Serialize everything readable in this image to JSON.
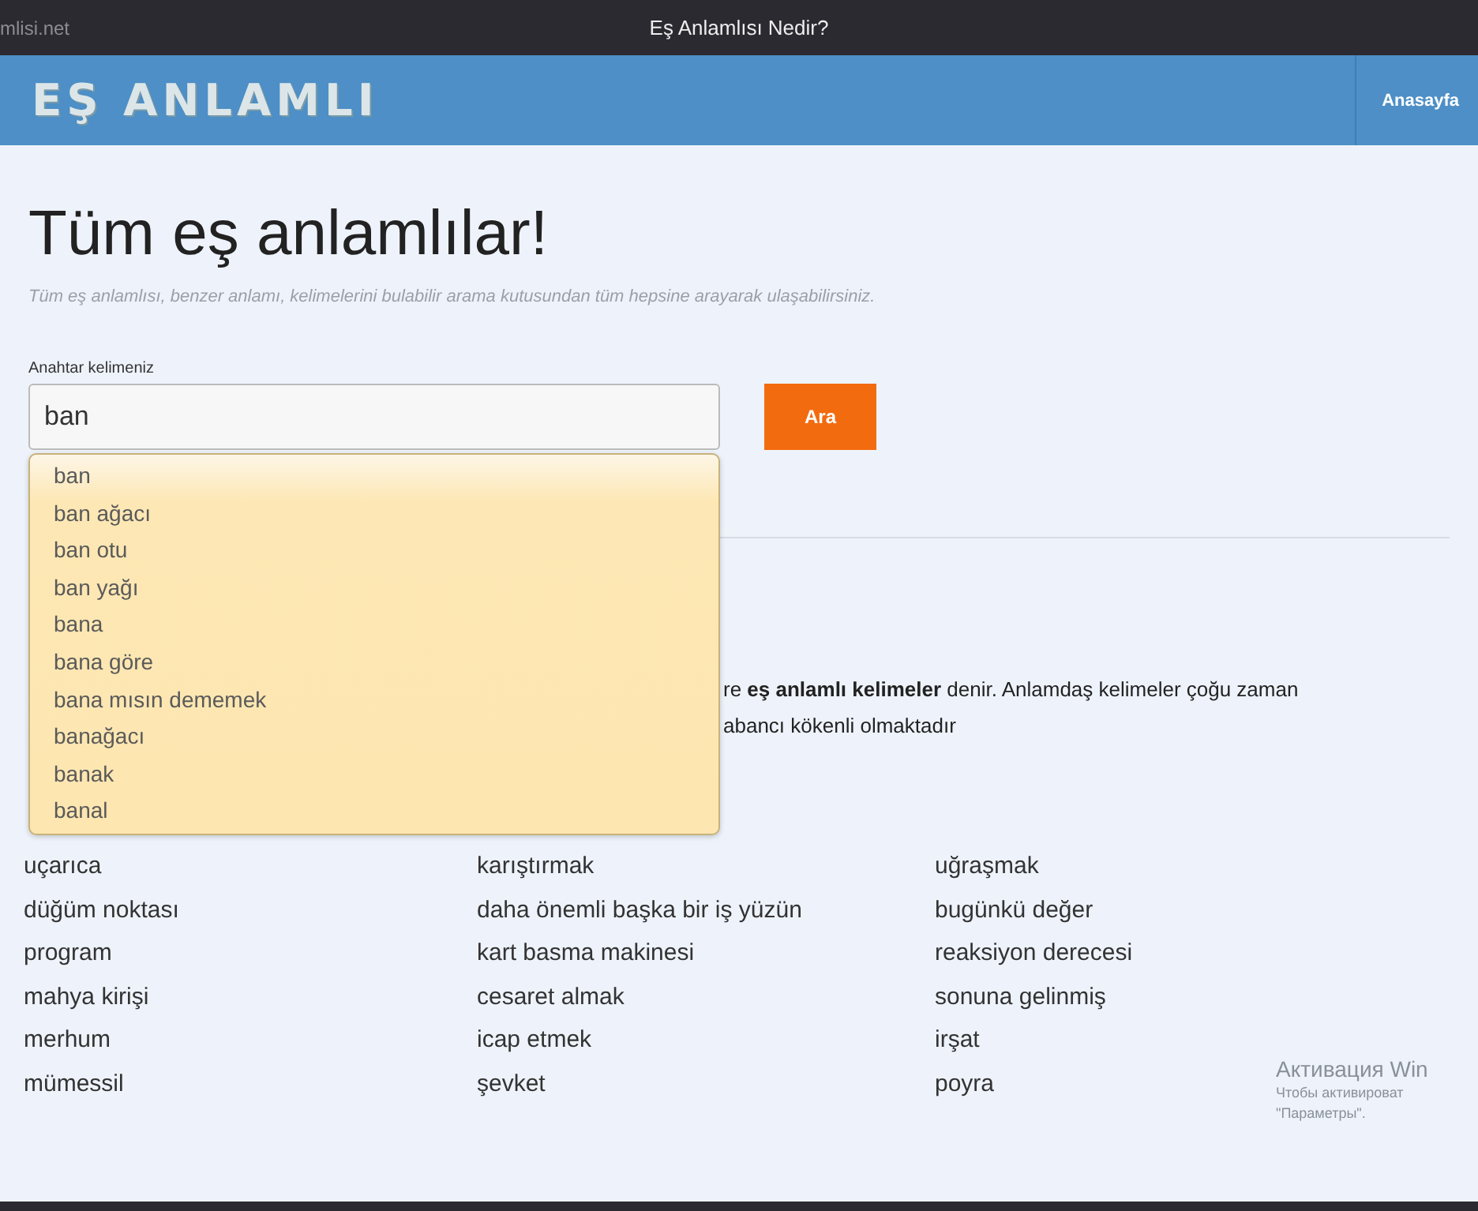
{
  "browser_bar": {
    "site": "mlisi.net",
    "title": "Eş Anlamlısı Nedir?"
  },
  "header": {
    "logo": "EŞ ANLAMLI",
    "nav": [
      "Anasayfa"
    ]
  },
  "heading": "Tüm eş anlamlılar!",
  "subtitle": "Tüm eş anlamlısı, benzer anlamı, kelimelerini bulabilir arama kutusundan tüm hepsine arayarak ulaşabilirsiniz.",
  "search": {
    "label": "Anahtar kelimeniz",
    "value": "ban",
    "button": "Ara"
  },
  "suggestions": [
    "ban",
    "ban ağacı",
    "ban otu",
    "ban yağı",
    "bana",
    "bana göre",
    "bana mısın dememek",
    "banağacı",
    "banak",
    "banal"
  ],
  "paragraph_lines": [
    "re **eş anlamlı kelimeler** denir. Anlamdaş kelimeler çoğu zaman",
    "abancı kökenli olmaktadır"
  ],
  "word_columns": [
    [
      "uçarıca",
      "düğüm noktası",
      "program",
      "mahya kirişi",
      "merhum",
      "mümessil"
    ],
    [
      "karıştırmak",
      "daha önemli başka bir iş yüzün",
      "kart basma makinesi",
      "cesaret almak",
      "icap etmek",
      "şevket"
    ],
    [
      "uğraşmak",
      "bugünkü değer",
      "reaksiyon derecesi",
      "sonuna gelinmiş",
      "irşat",
      "poyra"
    ]
  ],
  "activation_notice": {
    "title": "Активация Win",
    "lines": [
      "Чтобы активироват",
      "\"Параметры\"."
    ]
  }
}
